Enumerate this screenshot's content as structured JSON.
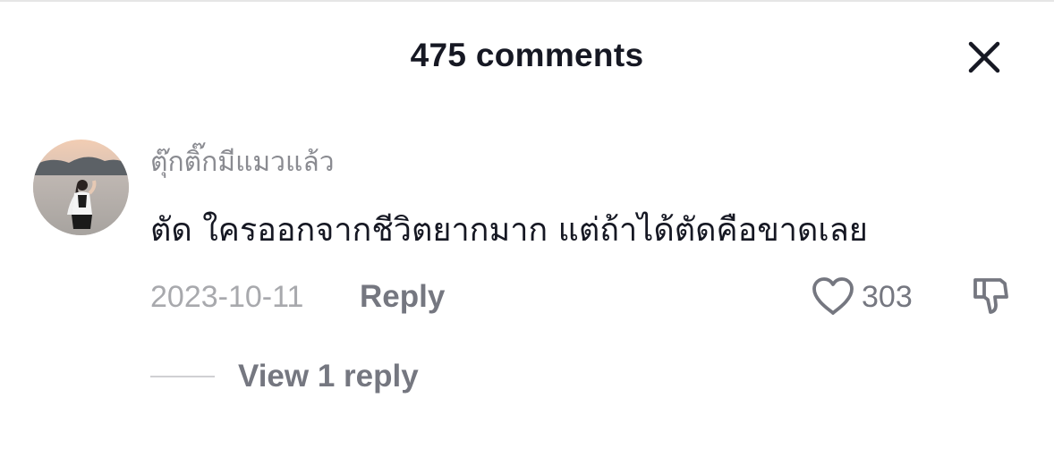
{
  "header": {
    "title": "475 comments",
    "close_icon": "close-icon"
  },
  "comment": {
    "avatar_icon": "avatar",
    "username": "ตุ๊กติ๊กมีแมวแล้ว",
    "text": "ตัด ใครออกจากชีวิตยากมาก แต่ถ้าได้ตัดคือขาดเลย",
    "date": "2023-10-11",
    "reply_label": "Reply",
    "like_icon": "heart-icon",
    "like_count": "303",
    "dislike_icon": "thumbs-down-icon",
    "view_replies_label": "View 1 reply"
  },
  "colors": {
    "text_primary": "#161823",
    "text_secondary": "#757780",
    "text_muted": "#a8a9ad",
    "username": "#8a8b91"
  }
}
